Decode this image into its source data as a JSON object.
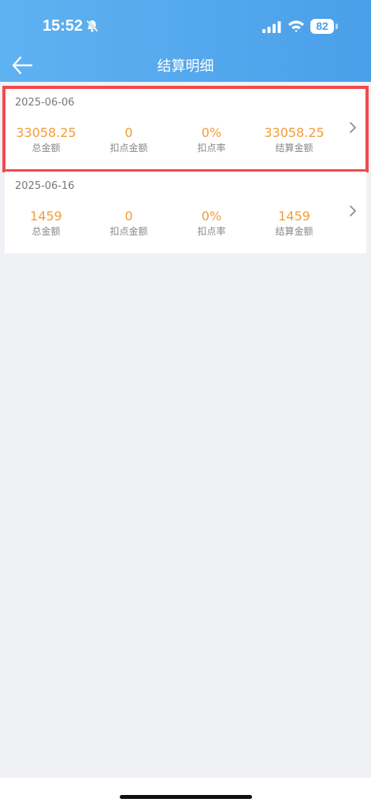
{
  "status_bar": {
    "time": "15:52",
    "battery": "82"
  },
  "nav": {
    "title": "结算明细"
  },
  "records": [
    {
      "date": "2025-06-06",
      "stats": [
        {
          "value": "33058.25",
          "label": "总金额"
        },
        {
          "value": "0",
          "label": "扣点金额"
        },
        {
          "value": "0%",
          "label": "扣点率"
        },
        {
          "value": "33058.25",
          "label": "结算金额"
        }
      ]
    },
    {
      "date": "2025-06-16",
      "stats": [
        {
          "value": "1459",
          "label": "总金额"
        },
        {
          "value": "0",
          "label": "扣点金额"
        },
        {
          "value": "0%",
          "label": "扣点率"
        },
        {
          "value": "1459",
          "label": "结算金额"
        }
      ]
    }
  ],
  "colors": {
    "header_start": "#5fb2f0",
    "header_end": "#4a9fea",
    "value_orange": "#f39c37",
    "highlight_red": "#f04b4b",
    "background": "#f0f1f5"
  }
}
